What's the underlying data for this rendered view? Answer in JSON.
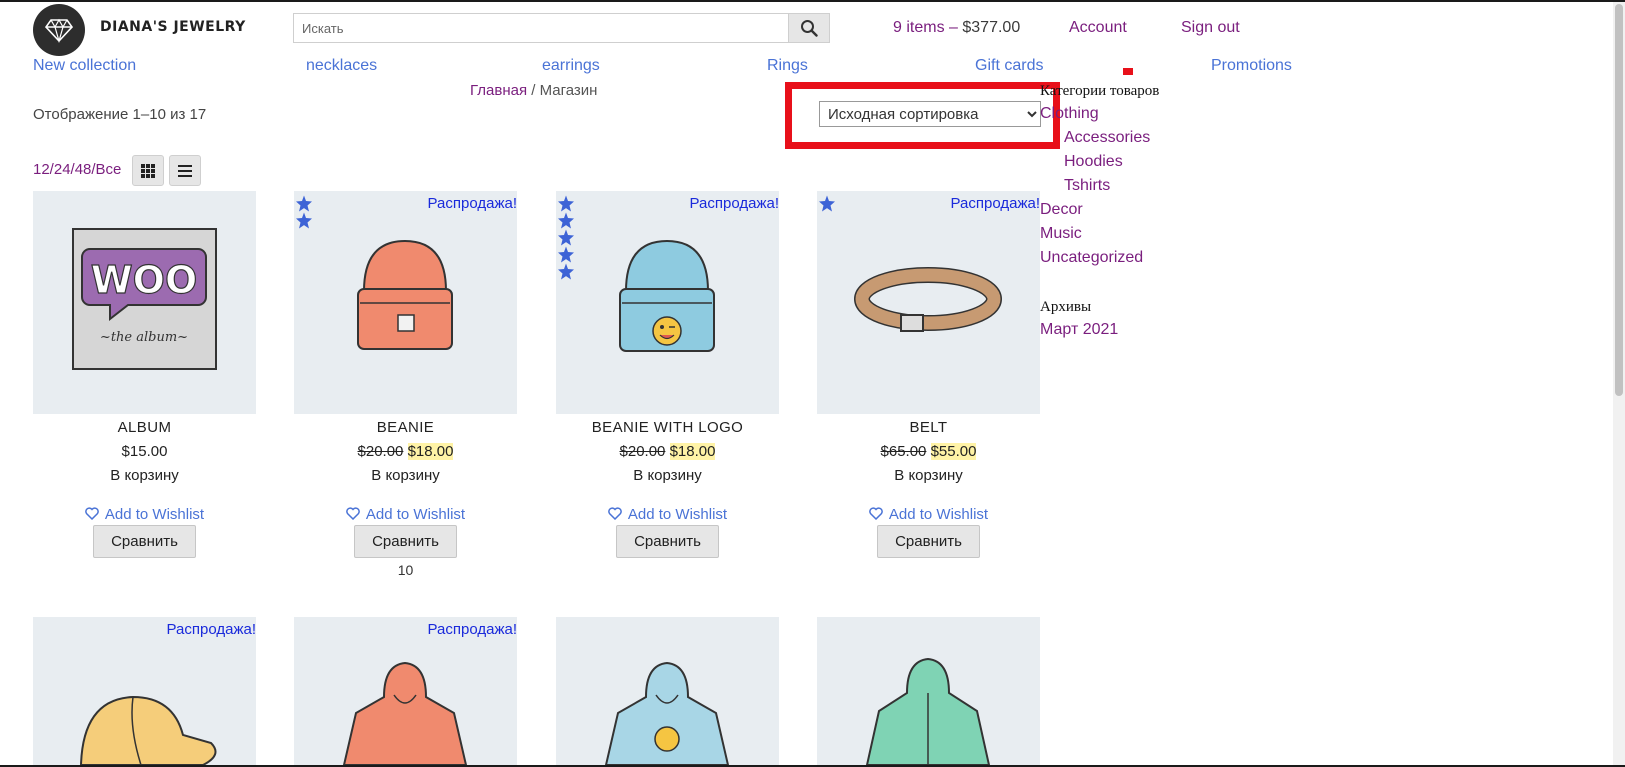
{
  "site": {
    "name": "DIANA'S JEWELRY"
  },
  "search": {
    "placeholder": "Искать"
  },
  "header": {
    "cart_count": "9 items",
    "cart_sep": " – ",
    "cart_total": "$377.00",
    "account": "Account",
    "signout": "Sign out"
  },
  "nav": {
    "new_collection": "New collection",
    "necklaces": "necklaces",
    "earrings": "earrings",
    "rings": "Rings",
    "gift_cards": "Gift cards",
    "promotions": "Promotions"
  },
  "breadcrumb": {
    "home": "Главная",
    "sep": " / ",
    "current": "Магазин"
  },
  "result_count": "Отображение 1–10 из 17",
  "sorting": {
    "selected": "Исходная сортировка"
  },
  "per_page": "12/24/48/Все",
  "sidebar": {
    "categories_title": "Категории товаров",
    "categories": {
      "clothing": "Clothing",
      "accessories": "Accessories",
      "hoodies": "Hoodies",
      "tshirts": "Tshirts",
      "decor": "Decor",
      "music": "Music",
      "uncategorized": "Uncategorized"
    },
    "archives_title": "Архивы",
    "archive_item": "Март 2021"
  },
  "labels": {
    "sale": "Распродажа!",
    "add_to_cart": "В корзину",
    "wishlist": "Add to Wishlist",
    "compare": "Сравнить"
  },
  "products": [
    {
      "name": "ALBUM",
      "price": "$15.00",
      "stars": 0,
      "sale": false
    },
    {
      "name": "BEANIE",
      "old_price": "$20.00",
      "price": "$18.00",
      "stars": 2,
      "sale": true,
      "extra": "10"
    },
    {
      "name": "BEANIE WITH LOGO",
      "old_price": "$20.00",
      "price": "$18.00",
      "stars": 5,
      "sale": true
    },
    {
      "name": "BELT",
      "old_price": "$65.00",
      "price": "$55.00",
      "stars": 1,
      "sale": true
    },
    {
      "sale": true
    },
    {
      "sale": true
    },
    {
      "sale": false
    },
    {
      "sale": false
    }
  ],
  "colors": {
    "link": "#7a1e7e",
    "nav": "#4a73d6",
    "sale": "#1a2adb",
    "highlight": "#e8101a"
  }
}
